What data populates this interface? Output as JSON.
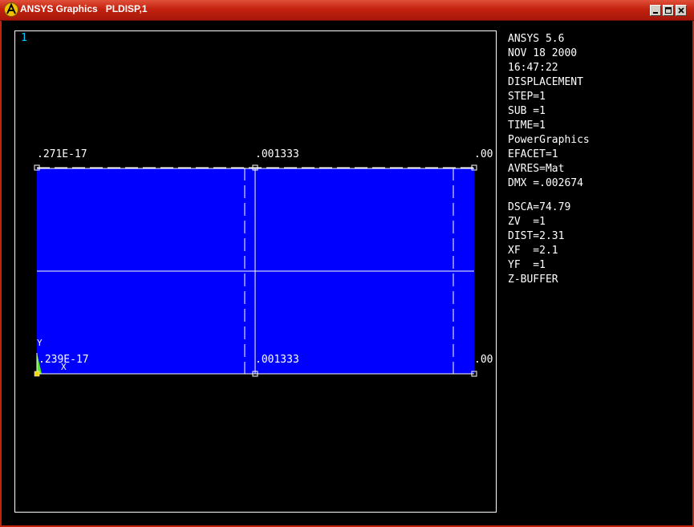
{
  "window": {
    "title": "ANSYS Graphics   PLDISP,1",
    "colors": {
      "titlebar": "#c3220e",
      "background": "#000000",
      "mesh": "#0000ff",
      "text": "#ffffff"
    }
  },
  "viewport": {
    "window_number": "1"
  },
  "plot_labels": {
    "top_left": ".271E-17",
    "top_middle": ".001333",
    "top_right": ".00",
    "bottom_left": ".239E-17",
    "bottom_middle": ".001333",
    "bottom_right": ".00",
    "axis_y": "Y",
    "axis_x": "X"
  },
  "info_panel": {
    "version": "ANSYS 5.6",
    "date": "NOV 18 2000",
    "time": "16:47:22",
    "plot_type": "DISPLACEMENT",
    "step": "STEP=1",
    "sub": "SUB =1",
    "time_value": "TIME=1",
    "graphics": "PowerGraphics",
    "efacet": "EFACET=1",
    "avres": "AVRES=Mat",
    "dmx": "DMX =.002674",
    "dsca": "DSCA=74.79",
    "zv": "ZV  =1",
    "dist": "DIST=2.31",
    "xf": "XF  =2.1",
    "yf": "YF  =1",
    "zbuffer": "Z-BUFFER"
  }
}
